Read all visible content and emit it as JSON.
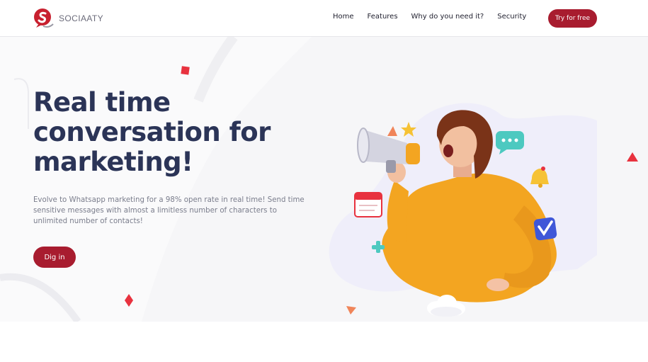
{
  "brand": {
    "name": "SOCIAATY",
    "accent": "#a81c2f",
    "heading_color": "#2b3457"
  },
  "nav": {
    "items": [
      {
        "label": "Home"
      },
      {
        "label": "Features"
      },
      {
        "label": "Why do you need it?"
      },
      {
        "label": "Security"
      }
    ],
    "cta_label": "Try for free"
  },
  "hero": {
    "headline_line1": "Real time",
    "headline_line2": "conversation for",
    "headline_line3": "marketing!",
    "subtext": "Evolve to Whatsapp marketing for a 98% open rate in real time! Send time sensitive messages with almost a limitless number of characters to unlimited number of contacts!",
    "cta_label": "Dig in"
  },
  "illustration": {
    "subject": "woman shouting into megaphone",
    "icons": [
      "megaphone-icon",
      "star-icon",
      "chat-bubble-icon",
      "bell-icon",
      "calendar-icon",
      "plus-icon",
      "check-badge-icon",
      "cloud-icon"
    ]
  }
}
